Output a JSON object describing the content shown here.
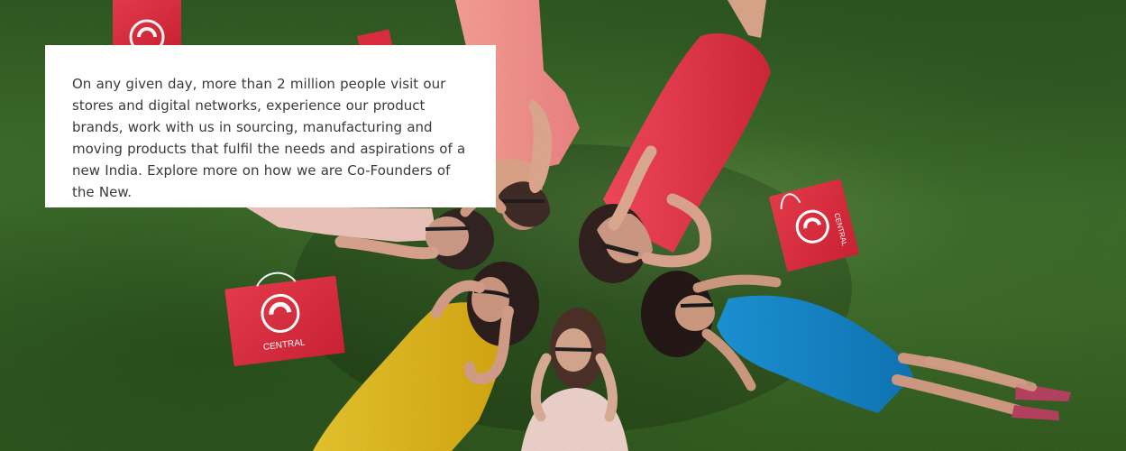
{
  "hero": {
    "description": "On any given day, more than 2 million people visit our stores and digital networks, experience our product brands, work with us in sourcing, manufacturing and moving products that fulfil the needs and aspirations of a new India. Explore more on how we are Co-Founders of the New.",
    "image": {
      "brand_text": "CENTRAL",
      "colors": {
        "grass": "#3c6b2c",
        "bag_red": "#d82d3d",
        "dress_yellow": "#d9b11c",
        "dress_blue": "#1481c3",
        "dress_pink": "#e78884",
        "dress_red": "#d73443"
      }
    }
  }
}
